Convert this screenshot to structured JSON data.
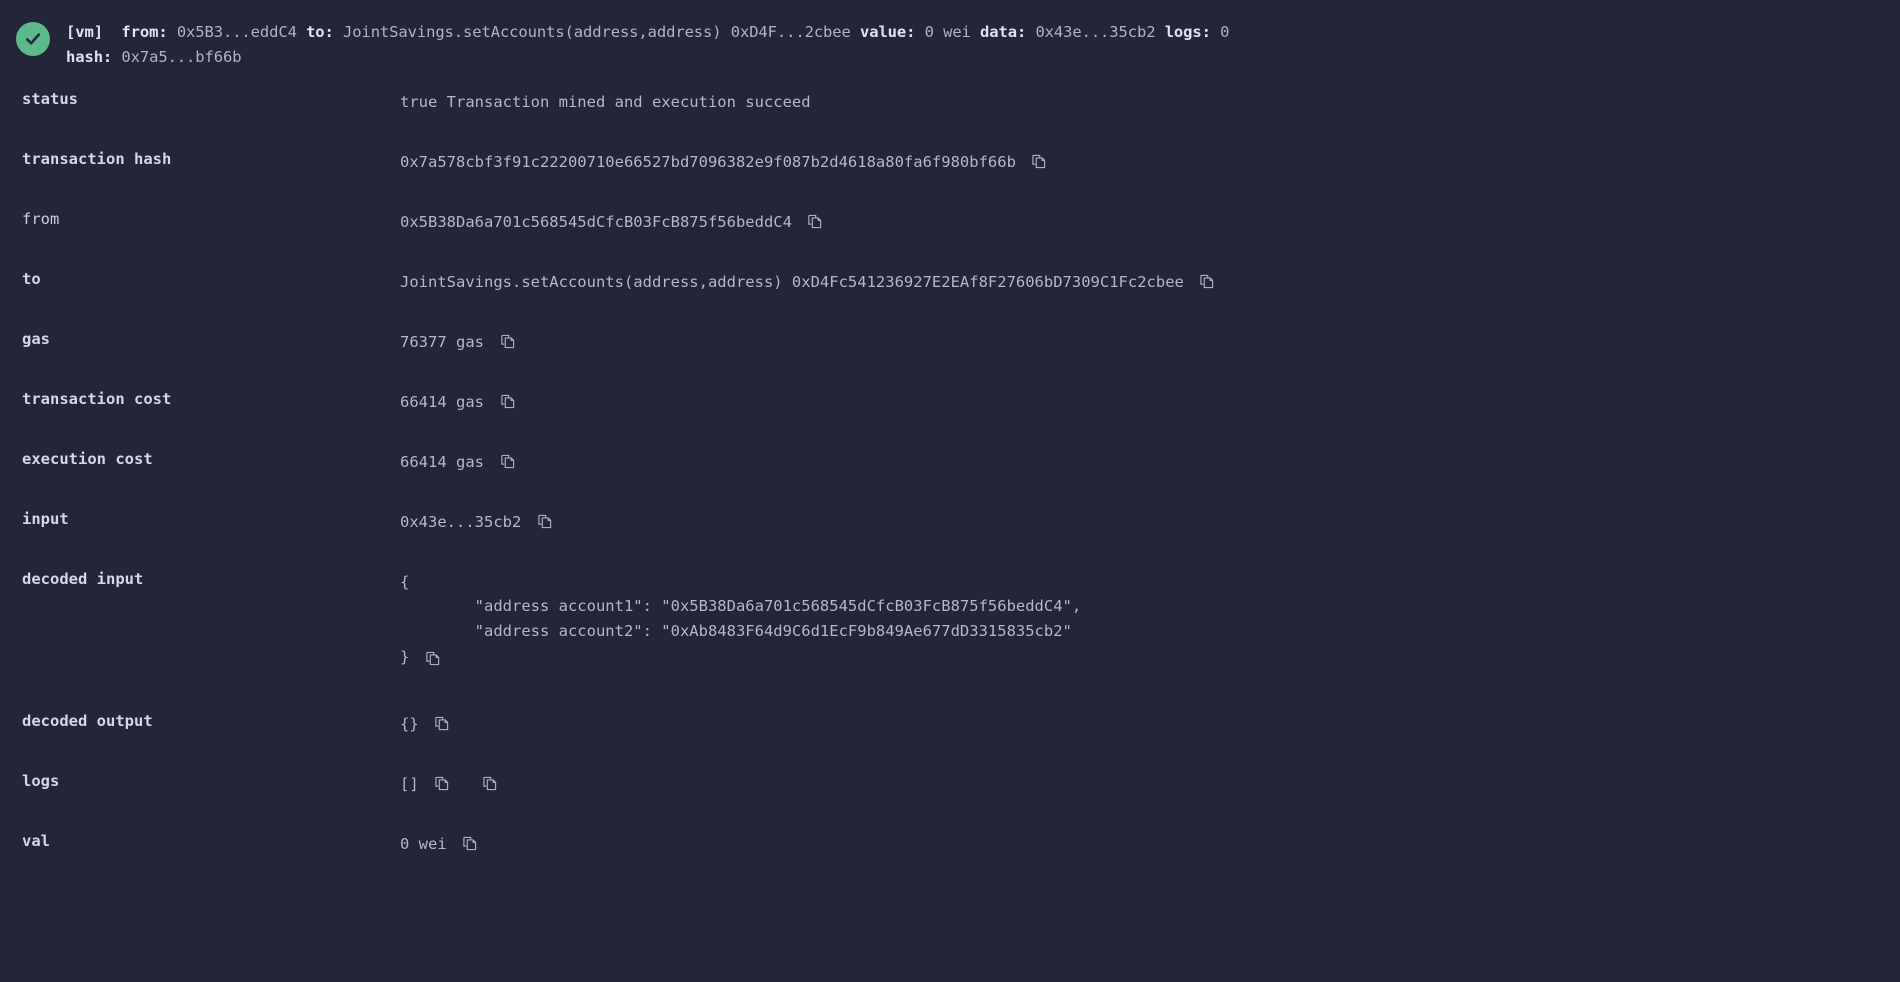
{
  "header": {
    "status_icon": "success-check-icon",
    "accent_green": "#5cb98b",
    "background": "#232539",
    "text_color": "#b9bed2",
    "line1": {
      "vm_tag": "[vm]",
      "from_label": "from:",
      "from_value": "0x5B3...eddC4",
      "to_label": "to:",
      "to_value": "JointSavings.setAccounts(address,address) 0xD4F...2cbee",
      "value_label": "value:",
      "value_value": "0 wei",
      "data_label": "data:",
      "data_value": "0x43e...35cb2",
      "logs_label": "logs:",
      "logs_value": "0"
    },
    "line2": {
      "hash_label": "hash:",
      "hash_value": "0x7a5...bf66b"
    }
  },
  "rows": [
    {
      "label": "status",
      "label_bold": true,
      "value": "true Transaction mined and execution succeed",
      "copy": false
    },
    {
      "label": "transaction hash",
      "label_bold": true,
      "value": "0x7a578cbf3f91c22200710e66527bd7096382e9f087b2d4618a80fa6f980bf66b",
      "copy": true
    },
    {
      "label": "from",
      "label_bold": false,
      "value": "0x5B38Da6a701c568545dCfcB03FcB875f56beddC4",
      "copy": true
    },
    {
      "label": "to",
      "label_bold": true,
      "value": "JointSavings.setAccounts(address,address) 0xD4Fc541236927E2EAf8F27606bD7309C1Fc2cbee",
      "copy": true
    },
    {
      "label": "gas",
      "label_bold": true,
      "value": "76377 gas",
      "copy": true
    },
    {
      "label": "transaction cost",
      "label_bold": true,
      "value": "66414 gas",
      "copy": true
    },
    {
      "label": "execution cost",
      "label_bold": true,
      "value": "66414 gas",
      "copy": true
    },
    {
      "label": "input",
      "label_bold": true,
      "value": "0x43e...35cb2",
      "copy": true
    }
  ],
  "decoded_input": {
    "label": "decoded input",
    "open_brace": "{",
    "line1": "        \"address account1\": \"0x5B38Da6a701c568545dCfcB03FcB875f56beddC4\",",
    "line2": "        \"address account2\": \"0xAb8483F64d9C6d1EcF9b849Ae677dD3315835cb2\"",
    "close_brace": "}"
  },
  "tail_rows": [
    {
      "label": "decoded output",
      "label_bold": true,
      "value": "{}",
      "copy_count": 1
    },
    {
      "label": "logs",
      "label_bold": true,
      "value": "[]",
      "copy_count": 2
    },
    {
      "label": "val",
      "label_bold": true,
      "value": "0 wei",
      "copy_count": 1
    }
  ],
  "icons": {
    "copy": "copy-icon",
    "check": "check-icon"
  }
}
